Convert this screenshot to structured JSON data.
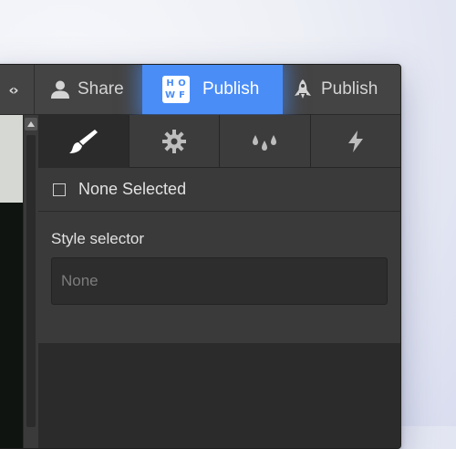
{
  "topbar": {
    "code_toggle_label": "‹›",
    "share_label": "Share",
    "publish_label": "Publish",
    "publish_secondary_label": "Publish",
    "logo_letters": [
      "H",
      "O",
      "W",
      "F"
    ],
    "accent_color": "#4a8df7"
  },
  "panel": {
    "tabs": [
      {
        "icon": "paintbrush-icon",
        "active": true
      },
      {
        "icon": "gear-icon",
        "active": false
      },
      {
        "icon": "drops-icon",
        "active": false
      },
      {
        "icon": "lightning-icon",
        "active": false
      }
    ],
    "selection": {
      "label": "None Selected"
    },
    "style_selector": {
      "label": "Style selector",
      "placeholder": "None"
    }
  }
}
